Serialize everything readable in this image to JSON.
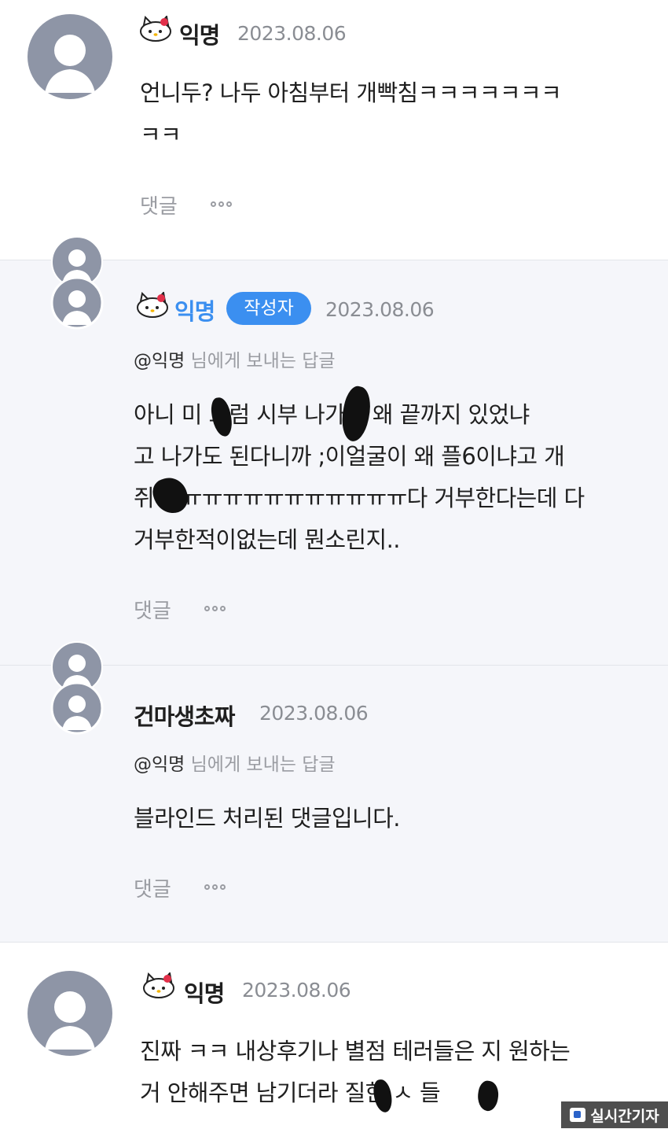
{
  "comments": [
    {
      "nickname": "익명",
      "date": "2023.08.06",
      "lines": [
        "언니두? 나두 아침부터 개빡침ㅋㅋㅋㅋㅋㅋㅋ",
        "ㅋㅋ"
      ],
      "reply_label": "댓글"
    },
    {
      "nickname": "익명",
      "badge": "작성자",
      "date": "2023.08.06",
      "reply_to_at": "@익명",
      "reply_to_suffix": " 님에게 보내는 답글",
      "lines": [
        "아니 미  그럼 시부  나가지 왜 끝까지 있었냐",
        "고 나가도 된다니까 ;이얼굴이 왜 플6이냐고 개",
        "쥐  ㅠㅠㅠㅠㅠㅠㅠㅠㅠㅠㅠㅠ다 거부한다는데 다",
        "거부한적이없는데 뭔소린지.."
      ],
      "reply_label": "댓글"
    },
    {
      "nickname": "건마생초짜",
      "date": "2023.08.06",
      "reply_to_at": "@익명",
      "reply_to_suffix": " 님에게 보내는 답글",
      "lines": [
        "블라인드 처리된 댓글입니다."
      ],
      "reply_label": "댓글"
    },
    {
      "nickname": "익명",
      "date": "2023.08.06",
      "lines": [
        "진짜 ㅋㅋ 내상후기나 별점 테러들은 지 원하는",
        "거 안해주면 남기더라  질한 ㅅ  들"
      ]
    }
  ],
  "watermark": "실시간기자",
  "colors": {
    "badge": "#3b8ff0",
    "author_nick": "#3b8ff0",
    "gray_bg": "#f5f6fa",
    "avatar": "#8e95a6",
    "meta": "#9a9ca2"
  },
  "icons": [
    "hello-kitty-icon",
    "default-avatar-icon",
    "more-dots-icon"
  ]
}
